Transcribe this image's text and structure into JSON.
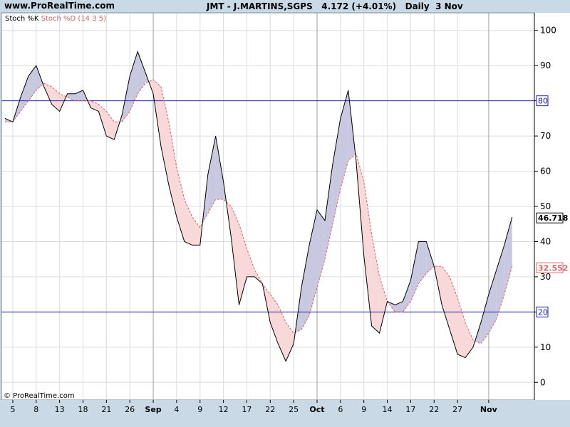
{
  "header": {
    "site": "www.ProRealTime.com",
    "instrument": "JMT - J.MARTINS,SGPS",
    "price": "4.172 (+4.01%)",
    "period": "Daily  3 Nov"
  },
  "legend": {
    "k_label": "Stoch %K",
    "d_label": "Stoch %D (14 3 5)"
  },
  "copyright": "© ProRealTime.com",
  "colors": {
    "panel_bg": "#ffffff",
    "outer_bg": "#c9d9e6",
    "k_line": "#000000",
    "d_line": "#e06060",
    "fill_k_above": "#c8c8e0",
    "fill_d_above": "#f8d8d8",
    "level_line": "#2020b0",
    "grid": "#dcdcdc"
  },
  "chart_data": {
    "type": "line",
    "x": [
      0,
      1,
      2,
      3,
      4,
      5,
      6,
      7,
      8,
      9,
      10,
      11,
      12,
      13,
      14,
      15,
      16,
      17,
      18,
      19,
      20,
      21,
      22,
      23,
      24,
      25,
      26,
      27,
      28,
      29,
      30,
      31,
      32,
      33,
      34,
      35,
      36,
      37,
      38,
      39,
      40,
      41,
      42,
      43,
      44,
      45,
      46,
      47,
      48,
      49,
      50,
      51,
      52,
      53,
      54,
      55,
      56,
      57,
      58,
      59,
      60,
      61,
      62,
      63,
      64
    ],
    "series": [
      {
        "name": "Stoch %K",
        "values": [
          75,
          74,
          81,
          87,
          90,
          84,
          79,
          77,
          82,
          82,
          83,
          78,
          77,
          70,
          69,
          76,
          87,
          94,
          88,
          82,
          67,
          56,
          47,
          40,
          39,
          39,
          59,
          70,
          57,
          41,
          22,
          30,
          30,
          28,
          17,
          11,
          6,
          11,
          27,
          39,
          49,
          46,
          62,
          75,
          83,
          63,
          36,
          16,
          14,
          23,
          22,
          23,
          29,
          40,
          40,
          33,
          22,
          15,
          8,
          7,
          10,
          17,
          25,
          32,
          39,
          47
        ],
        "values_note_trimmed": false
      },
      {
        "name": "Stoch %D (14 3 5)",
        "values": [
          74,
          74,
          77,
          80,
          83,
          85,
          84,
          82,
          81,
          80,
          80,
          80,
          79,
          77,
          74,
          74,
          77,
          82,
          85,
          86,
          84,
          74,
          61,
          52,
          47,
          44,
          48,
          52,
          52,
          50,
          45,
          38,
          32,
          28,
          25,
          22,
          17,
          14,
          15,
          19,
          27,
          35,
          45,
          55,
          63,
          65,
          57,
          42,
          30,
          23,
          20,
          20,
          23,
          28,
          31,
          33,
          33,
          30,
          24,
          17,
          12,
          11,
          14,
          18,
          25,
          33
        ]
      }
    ],
    "x_ticks": [
      {
        "label": "5",
        "pos": 1
      },
      {
        "label": "8",
        "pos": 4
      },
      {
        "label": "13",
        "pos": 7
      },
      {
        "label": "18",
        "pos": 10
      },
      {
        "label": "21",
        "pos": 13
      },
      {
        "label": "26",
        "pos": 16
      },
      {
        "label": "Sep",
        "pos": 19
      },
      {
        "label": "4",
        "pos": 22
      },
      {
        "label": "9",
        "pos": 25
      },
      {
        "label": "12",
        "pos": 28
      },
      {
        "label": "17",
        "pos": 31
      },
      {
        "label": "22",
        "pos": 34
      },
      {
        "label": "25",
        "pos": 37
      },
      {
        "label": "Oct",
        "pos": 40
      },
      {
        "label": "6",
        "pos": 43
      },
      {
        "label": "9",
        "pos": 46
      },
      {
        "label": "14",
        "pos": 49
      },
      {
        "label": "17",
        "pos": 52
      },
      {
        "label": "22",
        "pos": 55
      },
      {
        "label": "27",
        "pos": 58
      },
      {
        "label": "Nov",
        "pos": 62
      }
    ],
    "month_separators": [
      19,
      40,
      62
    ],
    "y_ticks": [
      0,
      10,
      20,
      30,
      40,
      50,
      60,
      70,
      80,
      90,
      100
    ],
    "ylim": [
      -5,
      105
    ],
    "levels": [
      80,
      20
    ],
    "level_labels": [
      "80",
      "20"
    ],
    "last_values": {
      "k": "46.718",
      "d": "32.552"
    }
  }
}
